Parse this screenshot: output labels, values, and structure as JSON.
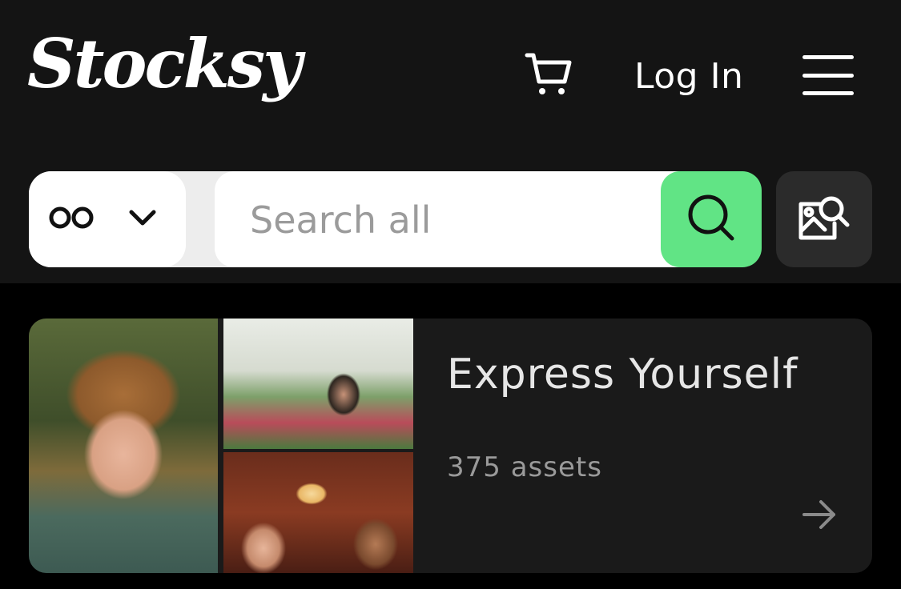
{
  "header": {
    "logo_text": "Stocksy",
    "cart_icon": "cart-icon",
    "login_label": "Log In",
    "menu_icon": "hamburger-menu-icon"
  },
  "search": {
    "type_selector_icon": "infinity-icon",
    "type_selector_chevron": "chevron-down-icon",
    "placeholder": "Search all",
    "value": "",
    "search_button_icon": "search-icon",
    "visual_search_icon": "image-search-icon",
    "accent_color": "#61e485"
  },
  "collection_card": {
    "title": "Express Yourself",
    "asset_count": "375 assets",
    "arrow_icon": "arrow-right-icon"
  },
  "colors": {
    "header_bg": "#141414",
    "page_bg": "#000000",
    "card_bg": "#1a1a1a"
  }
}
